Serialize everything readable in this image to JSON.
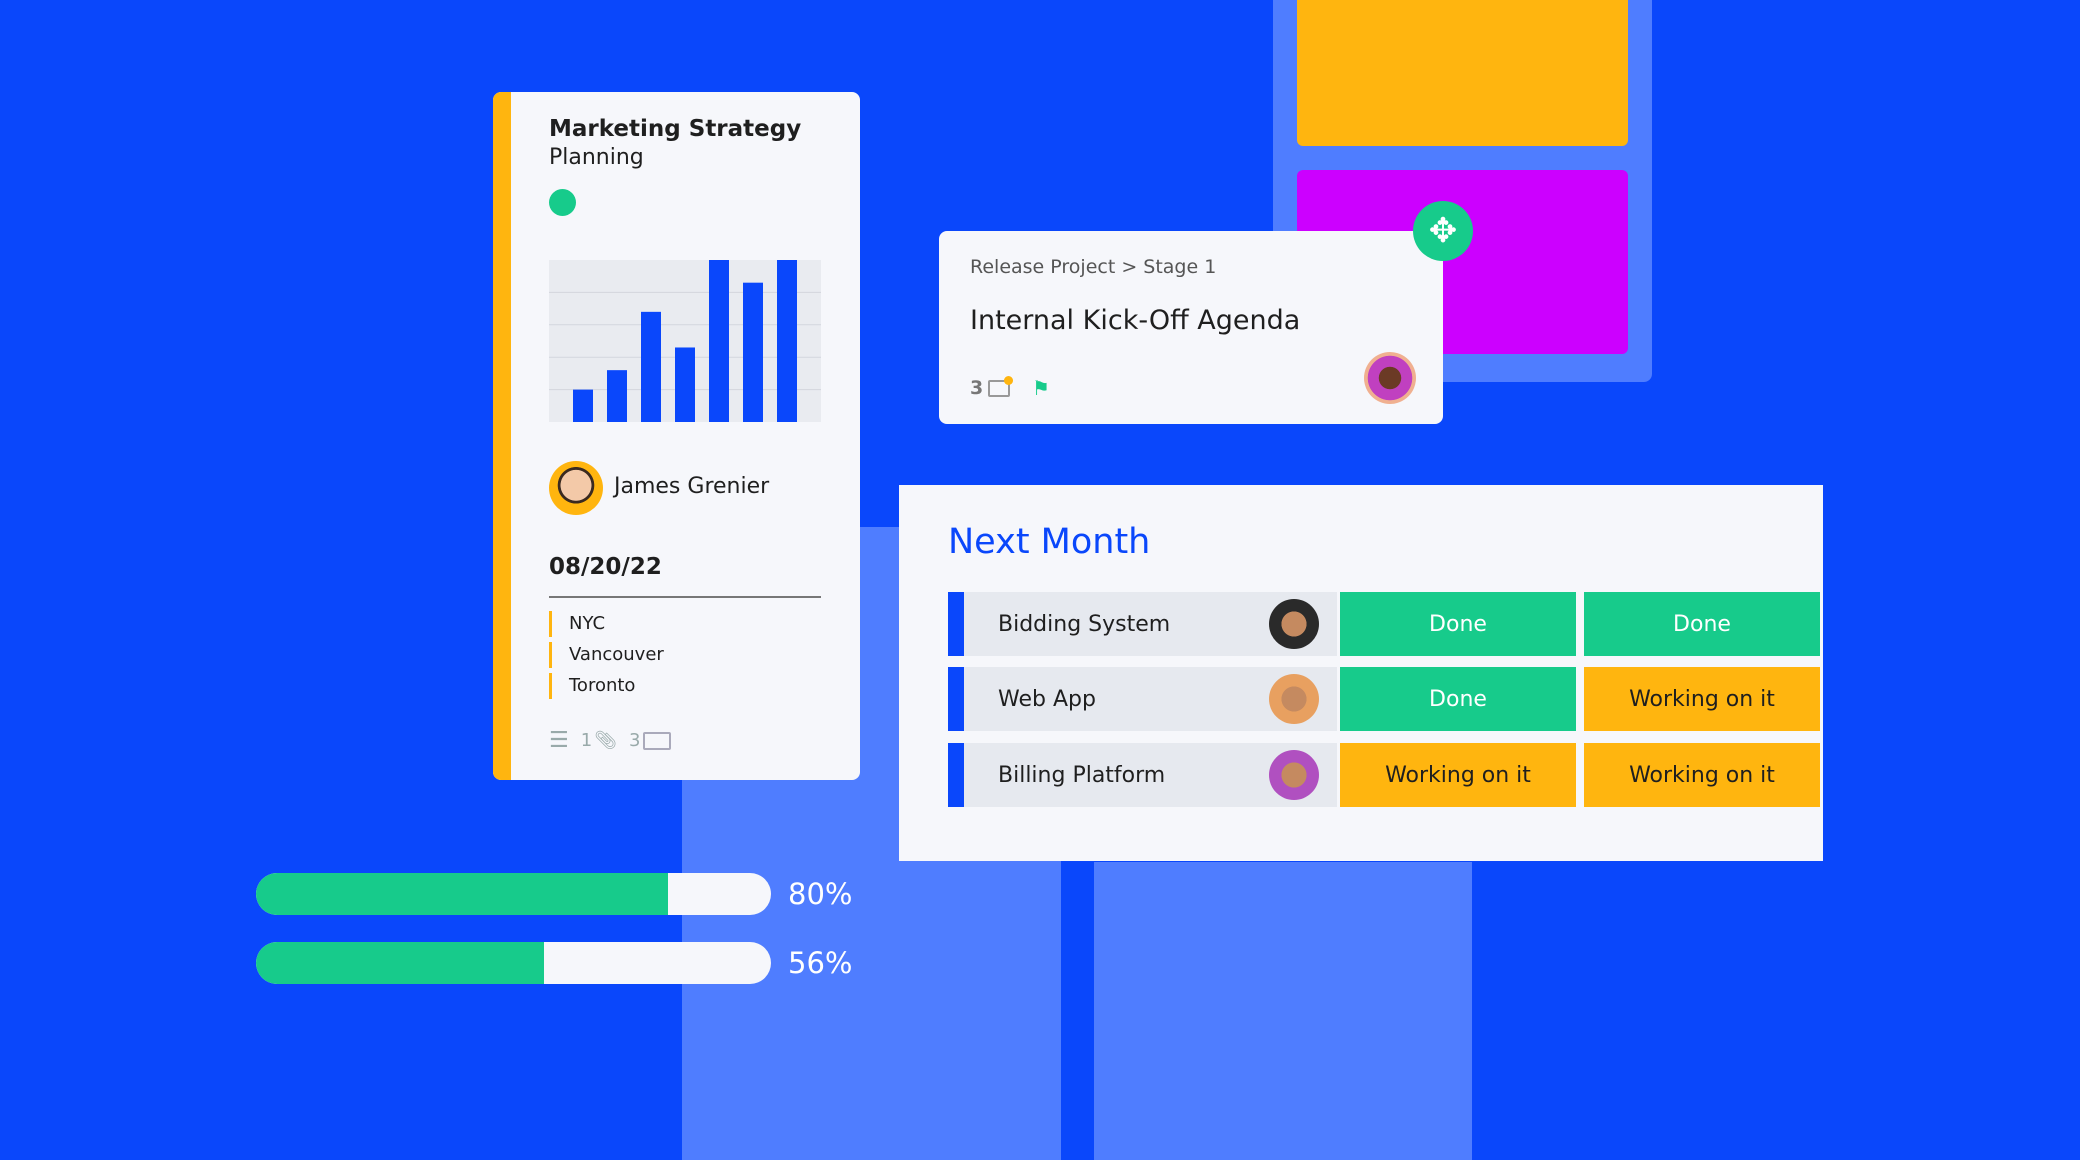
{
  "colors": {
    "background": "#0a47fb",
    "done": "#17cb8b",
    "working": "#ffb50f",
    "magenta": "#cc00ff",
    "accent": "#0a47fb"
  },
  "marketing_card": {
    "title": "Marketing Strategy",
    "subtitle": "Planning",
    "status_dot": "green",
    "chart_data": {
      "type": "bar",
      "values": [
        1.0,
        1.6,
        3.4,
        2.3,
        5.0,
        4.3,
        5.0
      ],
      "ylim": [
        0,
        5
      ],
      "grid": true
    },
    "person": "James Grenier",
    "date": "08/20/22",
    "locations": [
      "NYC",
      "Vancouver",
      "Toronto"
    ],
    "footer": {
      "checklist_icon": "list-icon",
      "attachments": "1",
      "comments": "3"
    }
  },
  "release_card": {
    "breadcrumb": "Release Project > Stage 1",
    "title": "Internal Kick-Off Agenda",
    "comments": "3",
    "flag_icon": "flag-icon",
    "move_icon": "move-icon"
  },
  "board": {
    "title": "Next Month",
    "rows": [
      {
        "name": "Bidding System",
        "status1": "Done",
        "status2": "Done"
      },
      {
        "name": "Web App",
        "status1": "Done",
        "status2": "Working on it"
      },
      {
        "name": "Billing Platform",
        "status1": "Working on it",
        "status2": "Working on it"
      }
    ]
  },
  "progress": [
    {
      "value": 80,
      "label": "80%"
    },
    {
      "value": 56,
      "label": "56%"
    }
  ]
}
